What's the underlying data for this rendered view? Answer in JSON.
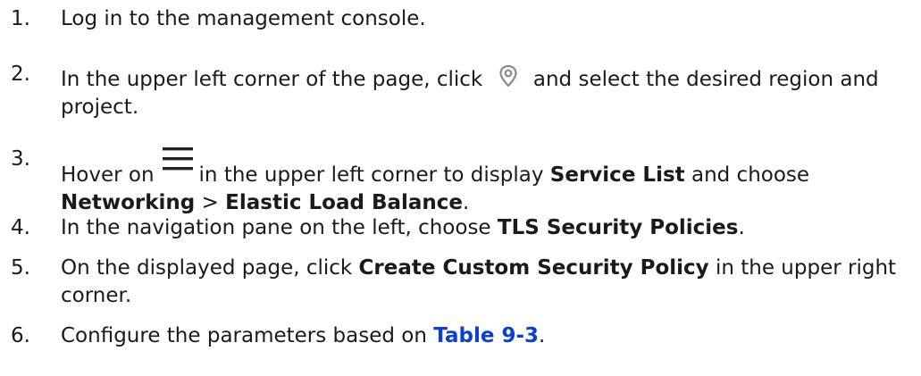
{
  "steps": [
    {
      "num": "1.",
      "text": "Log in to the management console."
    },
    {
      "num": "2.",
      "pre": "In the upper left corner of the page, click",
      "icon": "location-pin-icon",
      "post": "and select the desired region and project."
    },
    {
      "num": "3.",
      "pre": "Hover on",
      "icon": "menu-icon",
      "mid": "in the upper left corner to display",
      "bold1": "Service List",
      "mid2": "and choose",
      "bold2": "Networking",
      "sep": ">",
      "bold3": "Elastic Load Balance",
      "end": "."
    },
    {
      "num": "4.",
      "pre": "In the navigation pane on the left, choose",
      "bold": "TLS Security Policies",
      "end": "."
    },
    {
      "num": "5.",
      "pre": "On the displayed page, click",
      "bold": "Create Custom Security Policy",
      "post": "in the upper right corner."
    },
    {
      "num": "6.",
      "pre": "Configure the parameters based on",
      "link": "Table 9-3",
      "end": "."
    }
  ],
  "colors": {
    "text": "#1a1a1a",
    "link": "#0b3fd6",
    "icon": "#8a8a8a",
    "menu_icon": "#222222"
  }
}
